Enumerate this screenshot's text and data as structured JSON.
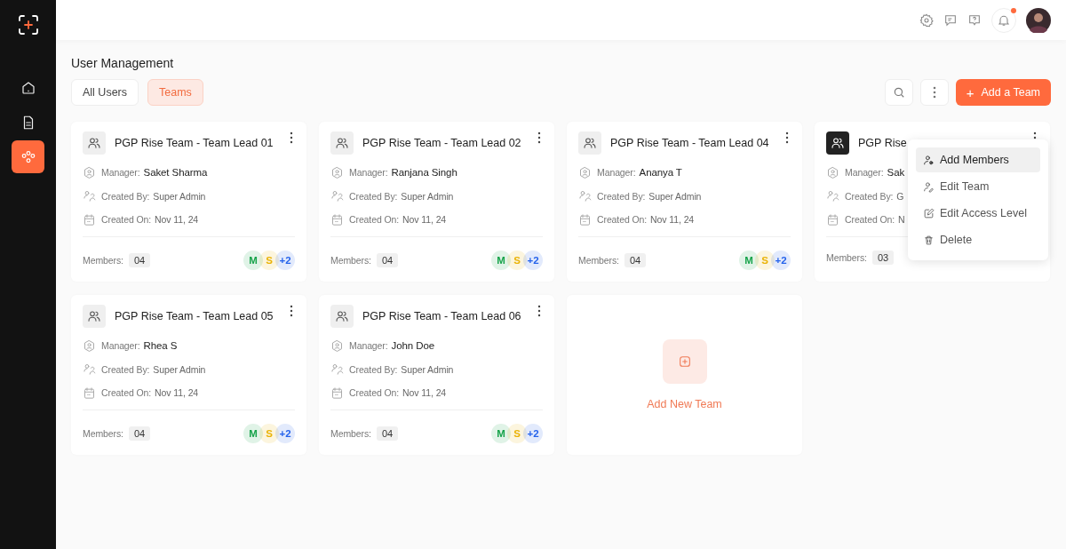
{
  "sidebar": {
    "items": [
      {
        "kind": "home",
        "selected": false
      },
      {
        "kind": "document",
        "selected": false
      },
      {
        "kind": "teams",
        "selected": true
      }
    ]
  },
  "header": {
    "notification_unread": true
  },
  "page": {
    "title": "User Management"
  },
  "tabs": [
    {
      "label": "All Users",
      "selected": false
    },
    {
      "label": "Teams",
      "selected": true
    }
  ],
  "toolbar": {
    "add_button": "Add a Team",
    "add_icon": "+"
  },
  "cards": [
    {
      "title": "PGP Rise Team - Team Lead 01",
      "selected": false,
      "fields": [
        {
          "kind": "manager",
          "label": "Manager:",
          "value": "Saket Sharma"
        },
        {
          "kind": "creator",
          "label": "Created By:",
          "value": "Super Admin"
        },
        {
          "kind": "date",
          "label": "Created On:",
          "value": "Nov 11, 24"
        }
      ],
      "members_label": "Members:",
      "members_count": "04",
      "avatars": [
        {
          "text": "M",
          "color": "#16a34a"
        },
        {
          "text": "S",
          "color": "#eab308"
        },
        {
          "text": "+2",
          "color": "#2563eb"
        }
      ]
    },
    {
      "title": "PGP Rise Team - Team Lead 02",
      "selected": false,
      "fields": [
        {
          "kind": "manager",
          "label": "Manager:",
          "value": "Ranjana Singh"
        },
        {
          "kind": "creator",
          "label": "Created By:",
          "value": "Super Admin"
        },
        {
          "kind": "date",
          "label": "Created On:",
          "value": "Nov 11, 24"
        }
      ],
      "members_label": "Members:",
      "members_count": "04",
      "avatars": [
        {
          "text": "M",
          "color": "#16a34a"
        },
        {
          "text": "S",
          "color": "#eab308"
        },
        {
          "text": "+2",
          "color": "#2563eb"
        }
      ]
    },
    {
      "title": "PGP Rise Team - Team Lead 04",
      "selected": false,
      "fields": [
        {
          "kind": "manager",
          "label": "Manager:",
          "value": "Ananya T"
        },
        {
          "kind": "creator",
          "label": "Created By:",
          "value": "Super Admin"
        },
        {
          "kind": "date",
          "label": "Created On:",
          "value": "Nov 11, 24"
        }
      ],
      "members_label": "Members:",
      "members_count": "04",
      "avatars": [
        {
          "text": "M",
          "color": "#16a34a"
        },
        {
          "text": "S",
          "color": "#eab308"
        },
        {
          "text": "+2",
          "color": "#2563eb"
        }
      ]
    },
    {
      "title": "PGP Rise",
      "selected": true,
      "fields": [
        {
          "kind": "manager",
          "label": "Manager:",
          "value": "Sak"
        },
        {
          "kind": "creator",
          "label": "Created By:",
          "value": "G"
        },
        {
          "kind": "date",
          "label": "Created On:",
          "value": "N"
        }
      ],
      "members_label": "Members:",
      "members_count": "03"
    },
    {
      "title": "PGP Rise Team - Team Lead 05",
      "selected": false,
      "fields": [
        {
          "kind": "manager",
          "label": "Manager:",
          "value": "Rhea S"
        },
        {
          "kind": "creator",
          "label": "Created By:",
          "value": "Super Admin"
        },
        {
          "kind": "date",
          "label": "Created On:",
          "value": "Nov 11, 24"
        }
      ],
      "members_label": "Members:",
      "members_count": "04",
      "avatars": [
        {
          "text": "M",
          "color": "#16a34a"
        },
        {
          "text": "S",
          "color": "#eab308"
        },
        {
          "text": "+2",
          "color": "#2563eb"
        }
      ]
    },
    {
      "title": "PGP Rise Team - Team Lead 06",
      "selected": false,
      "fields": [
        {
          "kind": "manager",
          "label": "Manager:",
          "value": "John Doe"
        },
        {
          "kind": "creator",
          "label": "Created By:",
          "value": "Super Admin"
        },
        {
          "kind": "date",
          "label": "Created On:",
          "value": "Nov 11, 24"
        }
      ],
      "members_label": "Members:",
      "members_count": "04",
      "avatars": [
        {
          "text": "M",
          "color": "#16a34a"
        },
        {
          "text": "S",
          "color": "#eab308"
        },
        {
          "text": "+2",
          "color": "#2563eb"
        }
      ]
    }
  ],
  "add_card": {
    "label": "Add New Team"
  },
  "menu": {
    "items": [
      {
        "kind": "add-member",
        "label": "Add Members",
        "selected": true
      },
      {
        "kind": "edit-member",
        "label": "Edit Team",
        "selected": false
      },
      {
        "kind": "edit",
        "label": "Edit Access Level",
        "selected": false
      },
      {
        "kind": "delete",
        "label": "Delete",
        "selected": false
      }
    ]
  }
}
